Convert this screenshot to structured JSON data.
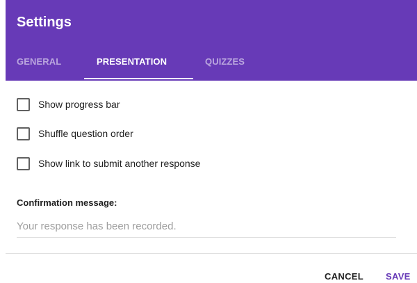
{
  "header": {
    "title": "Settings",
    "tabs": [
      {
        "label": "GENERAL",
        "active": false
      },
      {
        "label": "PRESENTATION",
        "active": true
      },
      {
        "label": "QUIZZES",
        "active": false
      }
    ]
  },
  "options": [
    {
      "label": "Show progress bar",
      "checked": false
    },
    {
      "label": "Shuffle question order",
      "checked": false
    },
    {
      "label": "Show link to submit another response",
      "checked": false
    }
  ],
  "confirmation": {
    "label": "Confirmation message:",
    "value": "",
    "placeholder": "Your response has been recorded."
  },
  "footer": {
    "cancel_label": "CANCEL",
    "save_label": "SAVE"
  },
  "colors": {
    "accent": "#673ab7",
    "header_text": "#ffffff"
  }
}
